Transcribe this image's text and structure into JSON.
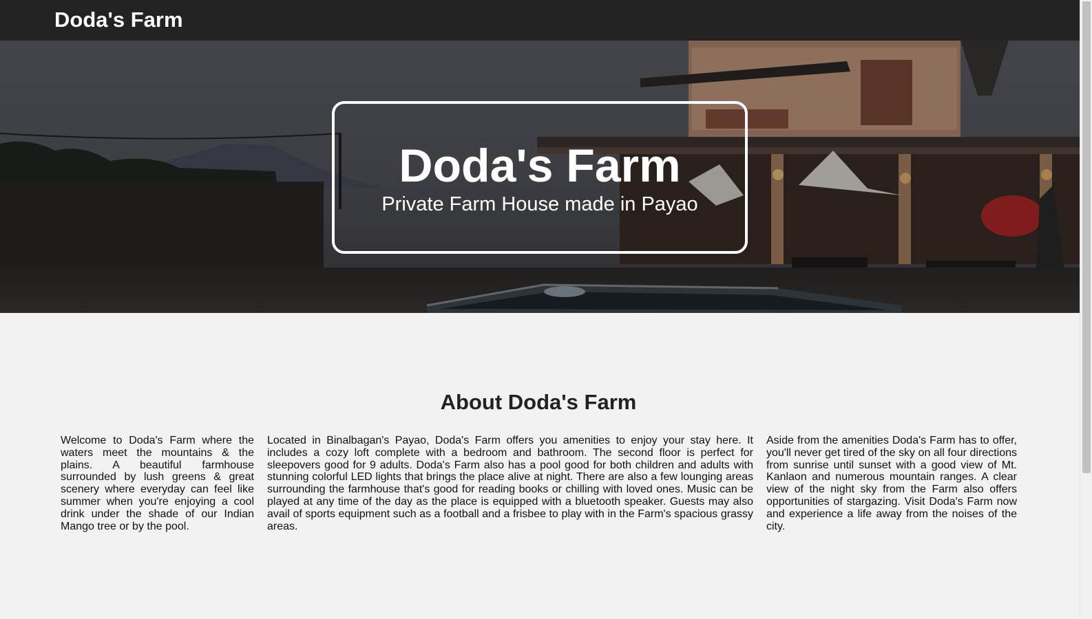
{
  "navbar": {
    "brand": "Doda's Farm"
  },
  "hero": {
    "title": "Doda's Farm",
    "subtitle": "Private Farm House made in Payao",
    "image_description": "dusk photo of a farmhouse with pool and mountain"
  },
  "about": {
    "title": "About Doda's Farm",
    "columns": [
      "Welcome to Doda's Farm where the waters meet the mountains & the plains. A beautiful farmhouse surrounded by lush greens & great scenery where everyday can feel like summer when you're enjoying a cool drink under the shade of our Indian Mango tree or by the pool.",
      "Located in Binalbagan's Payao, Doda's Farm offers you amenities to enjoy your stay here. It includes a cozy loft complete with a bedroom and bathroom. The second floor is perfect for sleepovers good for 9 adults. Doda's Farm also has a pool good for both children and adults with stunning colorful LED lights that brings the place alive at night. There are also a few lounging areas surrounding the farmhouse that's good for reading books or chilling with loved ones. Music can be played at any time of the day as the place is equipped with a bluetooth speaker. Guests may also avail of sports equipment such as a football and a frisbee to play with in the Farm's spacious grassy areas.",
      "Aside from the amenities Doda's Farm has to offer, you'll never get tired of the sky on all four directions from sunrise until sunset with a good view of Mt. Kanlaon and numerous mountain ranges. A clear view of the night sky from the Farm also offers opportunities of stargazing. Visit Doda's Farm now and experience a life away from the noises of the city."
    ]
  },
  "colors": {
    "navbar_bg": "#222222",
    "page_bg": "#f2f2f2",
    "text": "#111111",
    "hero_text": "#ffffff"
  }
}
